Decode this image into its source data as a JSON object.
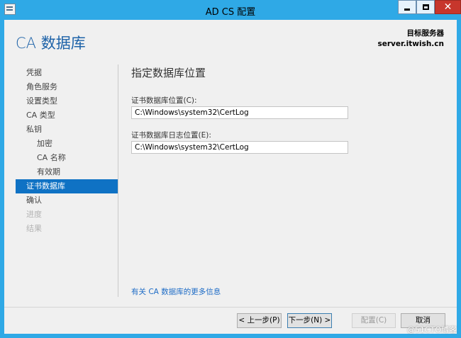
{
  "window": {
    "title": "AD CS 配置",
    "minimize_icon": "minimize-icon",
    "maximize_icon": "maximize-icon",
    "close_glyph": "✕"
  },
  "header": {
    "page_title": "CA 数据库",
    "target_label": "目标服务器",
    "target_server": "server.itwish.cn"
  },
  "nav": {
    "items": [
      {
        "label": "凭据",
        "state": "normal",
        "level": 0
      },
      {
        "label": "角色服务",
        "state": "normal",
        "level": 0
      },
      {
        "label": "设置类型",
        "state": "normal",
        "level": 0
      },
      {
        "label": "CA 类型",
        "state": "normal",
        "level": 0
      },
      {
        "label": "私钥",
        "state": "normal",
        "level": 0
      },
      {
        "label": "加密",
        "state": "normal",
        "level": 1
      },
      {
        "label": "CA 名称",
        "state": "normal",
        "level": 1
      },
      {
        "label": "有效期",
        "state": "normal",
        "level": 1
      },
      {
        "label": "证书数据库",
        "state": "selected",
        "level": 0
      },
      {
        "label": "确认",
        "state": "normal",
        "level": 0
      },
      {
        "label": "进度",
        "state": "disabled",
        "level": 0
      },
      {
        "label": "结果",
        "state": "disabled",
        "level": 0
      }
    ]
  },
  "main": {
    "section_title": "指定数据库位置",
    "db_label": "证书数据库位置(C):",
    "db_value": "C:\\Windows\\system32\\CertLog",
    "log_label": "证书数据库日志位置(E):",
    "log_value": "C:\\Windows\\system32\\CertLog",
    "more_info_link": "有关 CA 数据库的更多信息"
  },
  "footer": {
    "back": "< 上一步(P)",
    "next": "下一步(N) >",
    "configure": "配置(C)",
    "cancel": "取消"
  },
  "watermark": "@51CTO博客",
  "colors": {
    "titlebar": "#2fa9e6",
    "accent": "#0f72c4",
    "link": "#1e6cc6",
    "close": "#c7362c"
  }
}
